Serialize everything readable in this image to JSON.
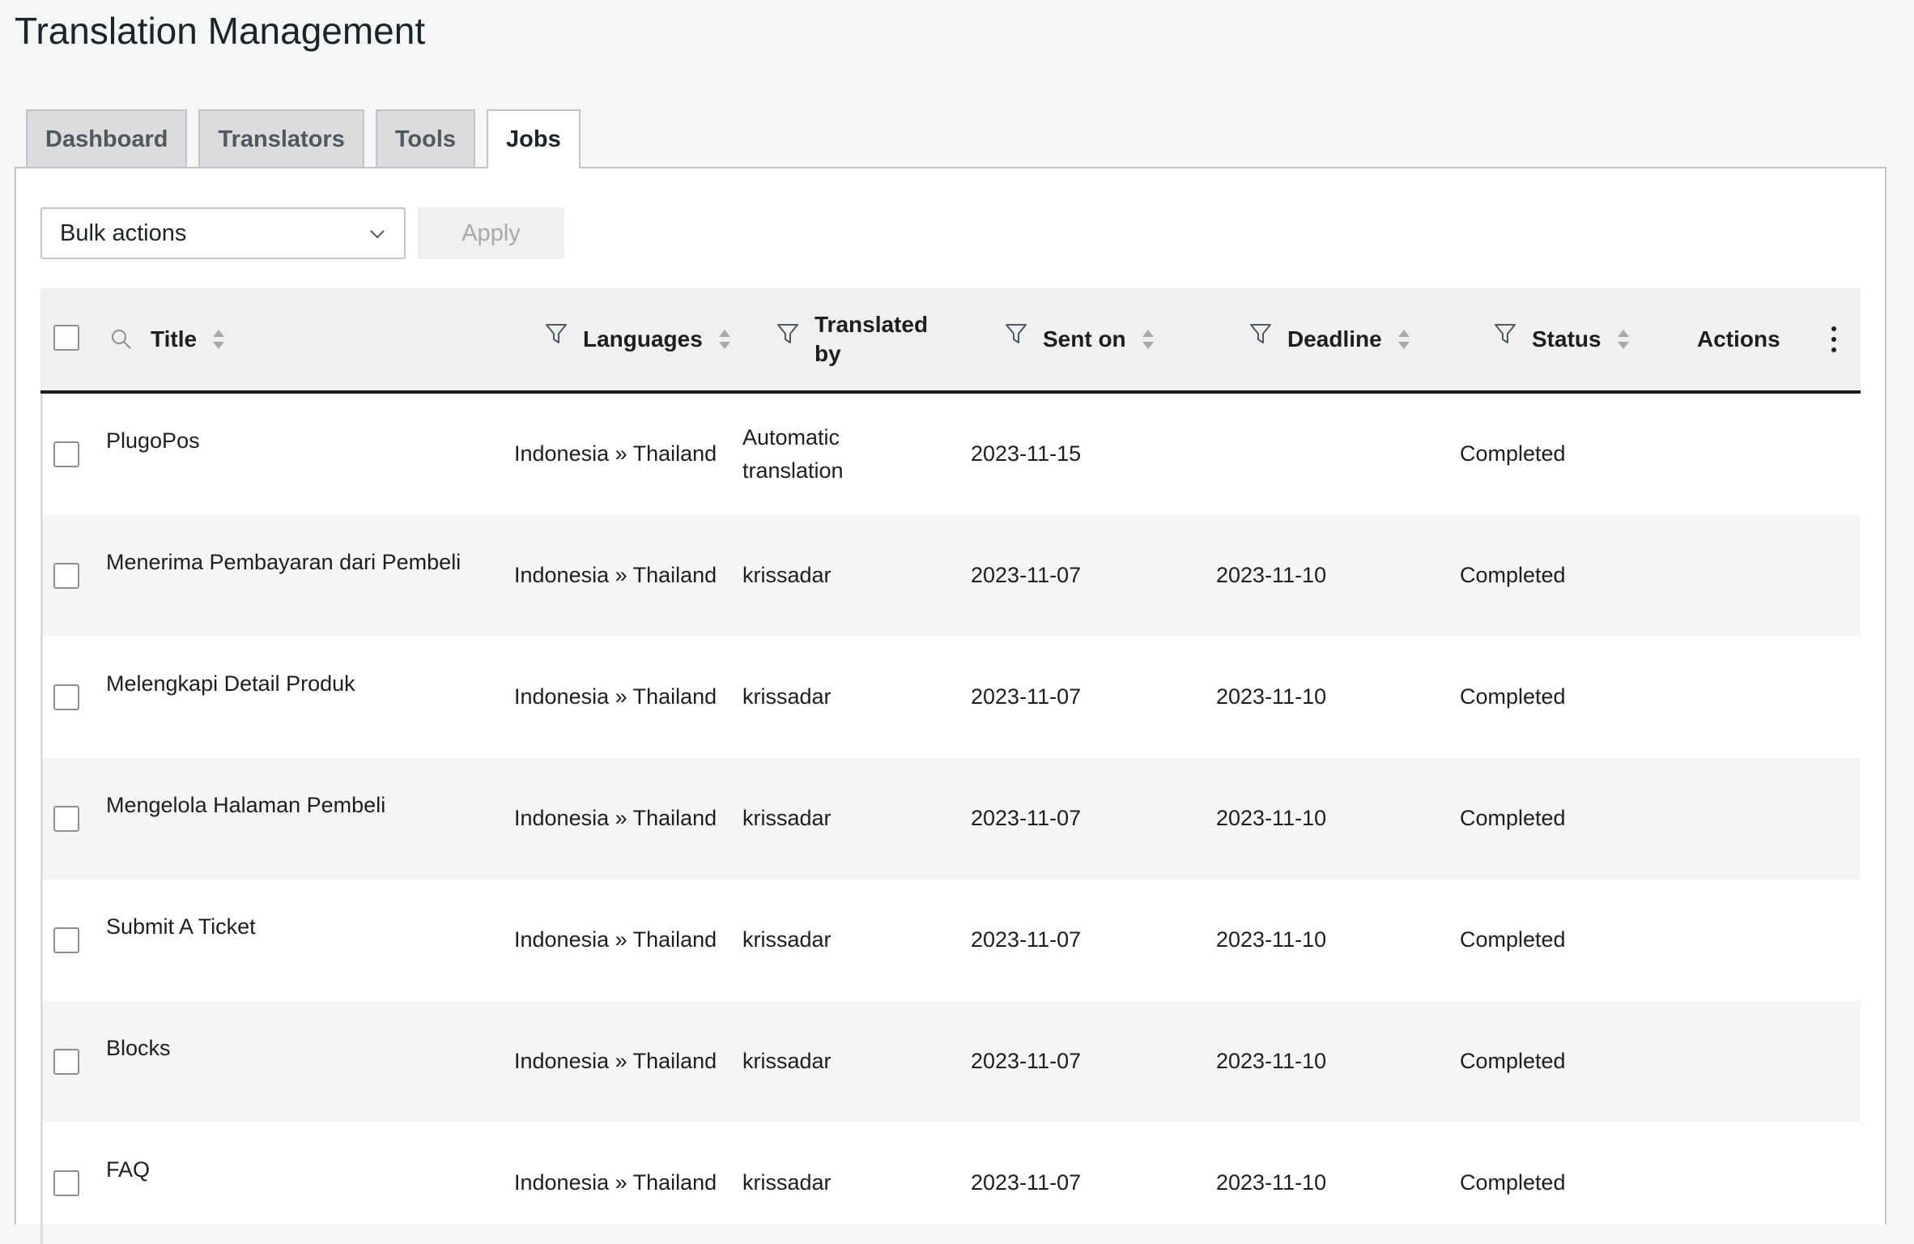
{
  "page": {
    "title": "Translation Management"
  },
  "tabs": [
    {
      "label": "Dashboard"
    },
    {
      "label": "Translators"
    },
    {
      "label": "Tools"
    },
    {
      "label": "Jobs"
    }
  ],
  "toolbar": {
    "bulk_actions": "Bulk actions",
    "apply": "Apply"
  },
  "columns": {
    "title": "Title",
    "languages": "Languages",
    "translated_by_1": "Translated",
    "translated_by_2": "by",
    "sent_on": "Sent on",
    "deadline": "Deadline",
    "status": "Status",
    "actions": "Actions"
  },
  "rows": [
    {
      "title": "PlugoPos",
      "languages": "Indonesia » Thailand",
      "translated_by_1": "Automatic",
      "translated_by_2": "translation",
      "sent_on": "2023-11-15",
      "deadline": "",
      "status": "Completed"
    },
    {
      "title": "Menerima Pembayaran dari Pembeli",
      "languages": "Indonesia » Thailand",
      "translated_by": "krissadar",
      "sent_on": "2023-11-07",
      "deadline": "2023-11-10",
      "status": "Completed"
    },
    {
      "title": "Melengkapi Detail Produk",
      "languages": "Indonesia » Thailand",
      "translated_by": "krissadar",
      "sent_on": "2023-11-07",
      "deadline": "2023-11-10",
      "status": "Completed"
    },
    {
      "title": "Mengelola Halaman Pembeli",
      "languages": "Indonesia » Thailand",
      "translated_by": "krissadar",
      "sent_on": "2023-11-07",
      "deadline": "2023-11-10",
      "status": "Completed"
    },
    {
      "title": "Submit A Ticket",
      "languages": "Indonesia » Thailand",
      "translated_by": "krissadar",
      "sent_on": "2023-11-07",
      "deadline": "2023-11-10",
      "status": "Completed"
    },
    {
      "title": "Blocks",
      "languages": "Indonesia » Thailand",
      "translated_by": "krissadar",
      "sent_on": "2023-11-07",
      "deadline": "2023-11-10",
      "status": "Completed"
    },
    {
      "title": "FAQ",
      "languages": "Indonesia » Thailand",
      "translated_by": "krissadar",
      "sent_on": "2023-11-07",
      "deadline": "2023-11-10",
      "status": "Completed"
    }
  ],
  "icons": {
    "search": "search-icon",
    "filter": "filter-icon",
    "sort": "sort-icon",
    "chevron": "chevron-down-icon",
    "kebab": "more-vertical-icon"
  },
  "colors": {
    "header_border": "#1e1e1e",
    "row_alt": "#f5f5f5",
    "tab_bg": "#dcdcde"
  }
}
